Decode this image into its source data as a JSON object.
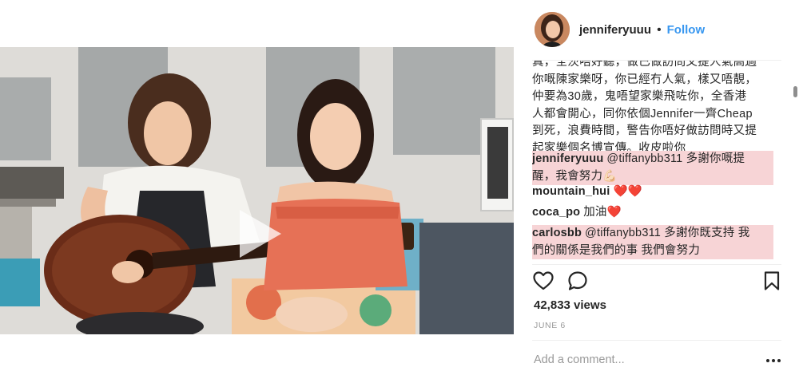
{
  "post": {
    "username": "jenniferyuuu",
    "separator": "•",
    "follow_label": "Follow"
  },
  "caption": {
    "lines": [
      "真，全茨唔好聽，做已做訪問又提人氣高過",
      "你嘅陳家樂呀，你已經冇人氣，樣又唔靚，",
      "仲要為30歲，鬼唔望家樂飛咗你，全香港",
      "人都會開心，同你依個Jennifer一齊Cheap",
      "到死，浪費時間，警告你唔好做訪問時又提",
      "起家樂個名博宣傳。收皮啦你"
    ]
  },
  "comments": [
    {
      "author": "jenniferyuuu",
      "lines": [
        "@tiffanybb311 多謝你嘅提",
        "醒，我會努力💪🏻"
      ],
      "highlighted": true
    },
    {
      "author": "mountain_hui",
      "lines": [
        "❤️❤️"
      ],
      "highlighted": false
    },
    {
      "author": "coca_po",
      "lines": [
        "加油❤️"
      ],
      "highlighted": false
    },
    {
      "author": "carlosbb",
      "lines": [
        "@tiffanybb311 多謝你既支持 我",
        "們的關係是我們的事 我們會努力"
      ],
      "highlighted": true
    }
  ],
  "stats": {
    "views": "42,833 views",
    "date": "JUNE 6"
  },
  "composer": {
    "placeholder": "Add a comment...",
    "more_glyph": "•••"
  },
  "icons": {
    "like": "heart-icon",
    "comment": "comment-bubble-icon",
    "save": "bookmark-icon",
    "more": "more-options-icon",
    "play": "play-icon"
  },
  "colors": {
    "follow": "#3897f0",
    "highlight": "#f7d4d6",
    "muted": "#999999",
    "text": "#262626"
  }
}
